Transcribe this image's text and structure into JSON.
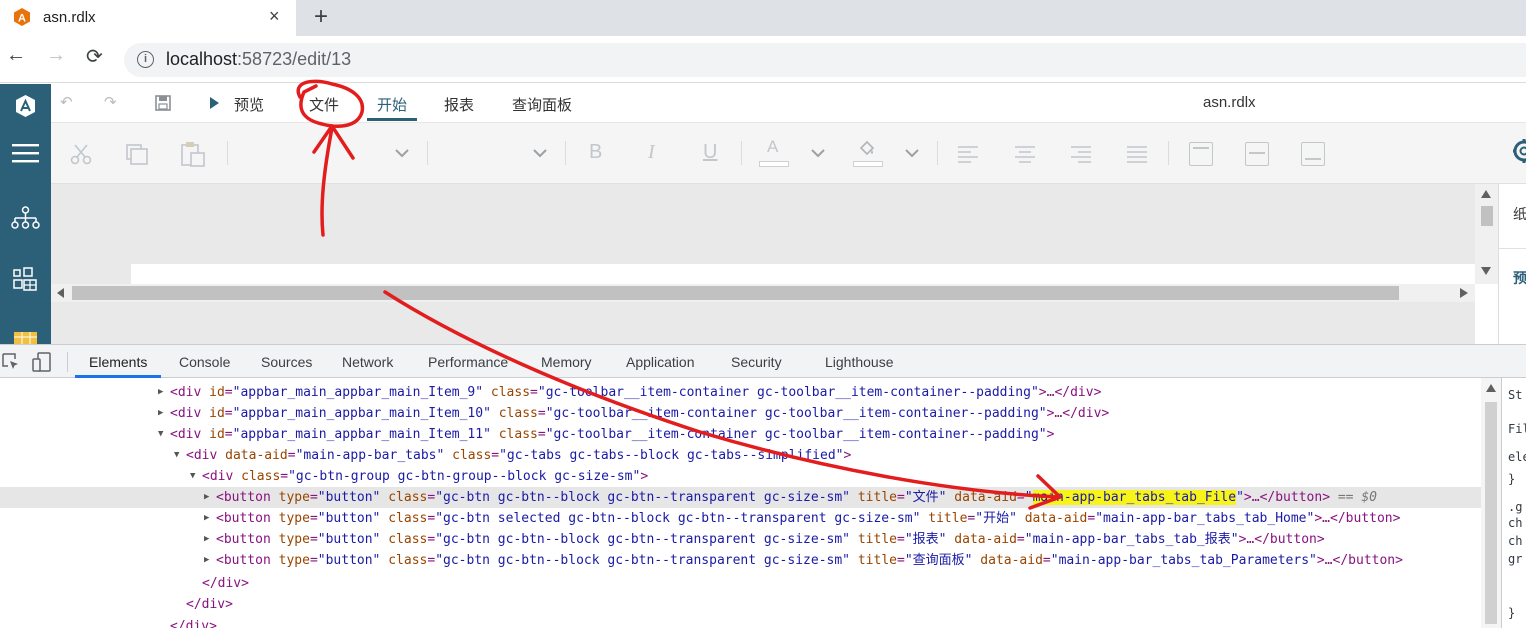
{
  "browser": {
    "tab_title": "asn.rdlx",
    "new_tab": "+",
    "tab_close": "×",
    "url_host": "localhost",
    "url_path": ":58723/edit/13",
    "nav": {
      "back": "←",
      "forward": "→",
      "reload": "⟳"
    }
  },
  "appbar": {
    "undo": "↶",
    "redo": "↷",
    "save_icon": "save-icon",
    "preview_label": "预览",
    "tabs": [
      {
        "label": "文件"
      },
      {
        "label": "开始"
      },
      {
        "label": "报表"
      },
      {
        "label": "查询面板"
      }
    ],
    "active_tab": "开始",
    "document_name": "asn.rdlx"
  },
  "toolbar": {
    "bold": "B",
    "italic": "I",
    "underline": "U",
    "font_color": "A"
  },
  "side_panel": {
    "label_1": "纸",
    "label_2": "预"
  },
  "devtools": {
    "tabs": [
      "Elements",
      "Console",
      "Sources",
      "Network",
      "Performance",
      "Memory",
      "Application",
      "Security",
      "Lighthouse"
    ],
    "active_tab": "Elements",
    "lines": [
      {
        "t": "<div id=\"appbar_main_appbar_main_Item_9\" class=\"gc-toolbar__item-container gc-toolbar__item-container--padding\">…</div>"
      },
      {
        "t": "<div id=\"appbar_main_appbar_main_Item_10\" class=\"gc-toolbar__item-container gc-toolbar__item-container--padding\">…</div>"
      },
      {
        "t": "<div id=\"appbar_main_appbar_main_Item_11\" class=\"gc-toolbar__item-container gc-toolbar__item-container--padding\">"
      },
      {
        "t": "<div data-aid=\"main-app-bar_tabs\" class=\"gc-tabs gc-tabs--block gc-tabs--simplified\">"
      },
      {
        "t": "<div class=\"gc-btn-group gc-btn-group--block gc-size-sm\">"
      },
      {
        "t": "<button type=\"button\" class=\"gc-btn gc-btn--block gc-btn--transparent gc-size-sm\" title=\"文件\" data-aid=\"main-app-bar_tabs_tab_File\">…</button> == $0"
      },
      {
        "t": "<button type=\"button\" class=\"gc-btn selected gc-btn--block gc-btn--transparent gc-size-sm\" title=\"开始\" data-aid=\"main-app-bar_tabs_tab_Home\">…</button>"
      },
      {
        "t": "<button type=\"button\" class=\"gc-btn gc-btn--block gc-btn--transparent gc-size-sm\" title=\"报表\" data-aid=\"main-app-bar_tabs_tab_报表\">…</button>"
      },
      {
        "t": "<button type=\"button\" class=\"gc-btn gc-btn--block gc-btn--transparent gc-size-sm\" title=\"查询面板\" data-aid=\"main-app-bar_tabs_tab_Parameters\">…</button>"
      },
      {
        "t": "</div>"
      },
      {
        "t": "</div>"
      },
      {
        "t": "</div>"
      }
    ],
    "styles_lines": [
      "St",
      "Fil",
      "ele",
      "}",
      ".g",
      "ch",
      "ch",
      "gr",
      "}"
    ]
  },
  "colors": {
    "accent": "#2c6079",
    "annotation": "#e31d1d",
    "highlight": "#f8f318",
    "devtools_active": "#1a73e8"
  }
}
